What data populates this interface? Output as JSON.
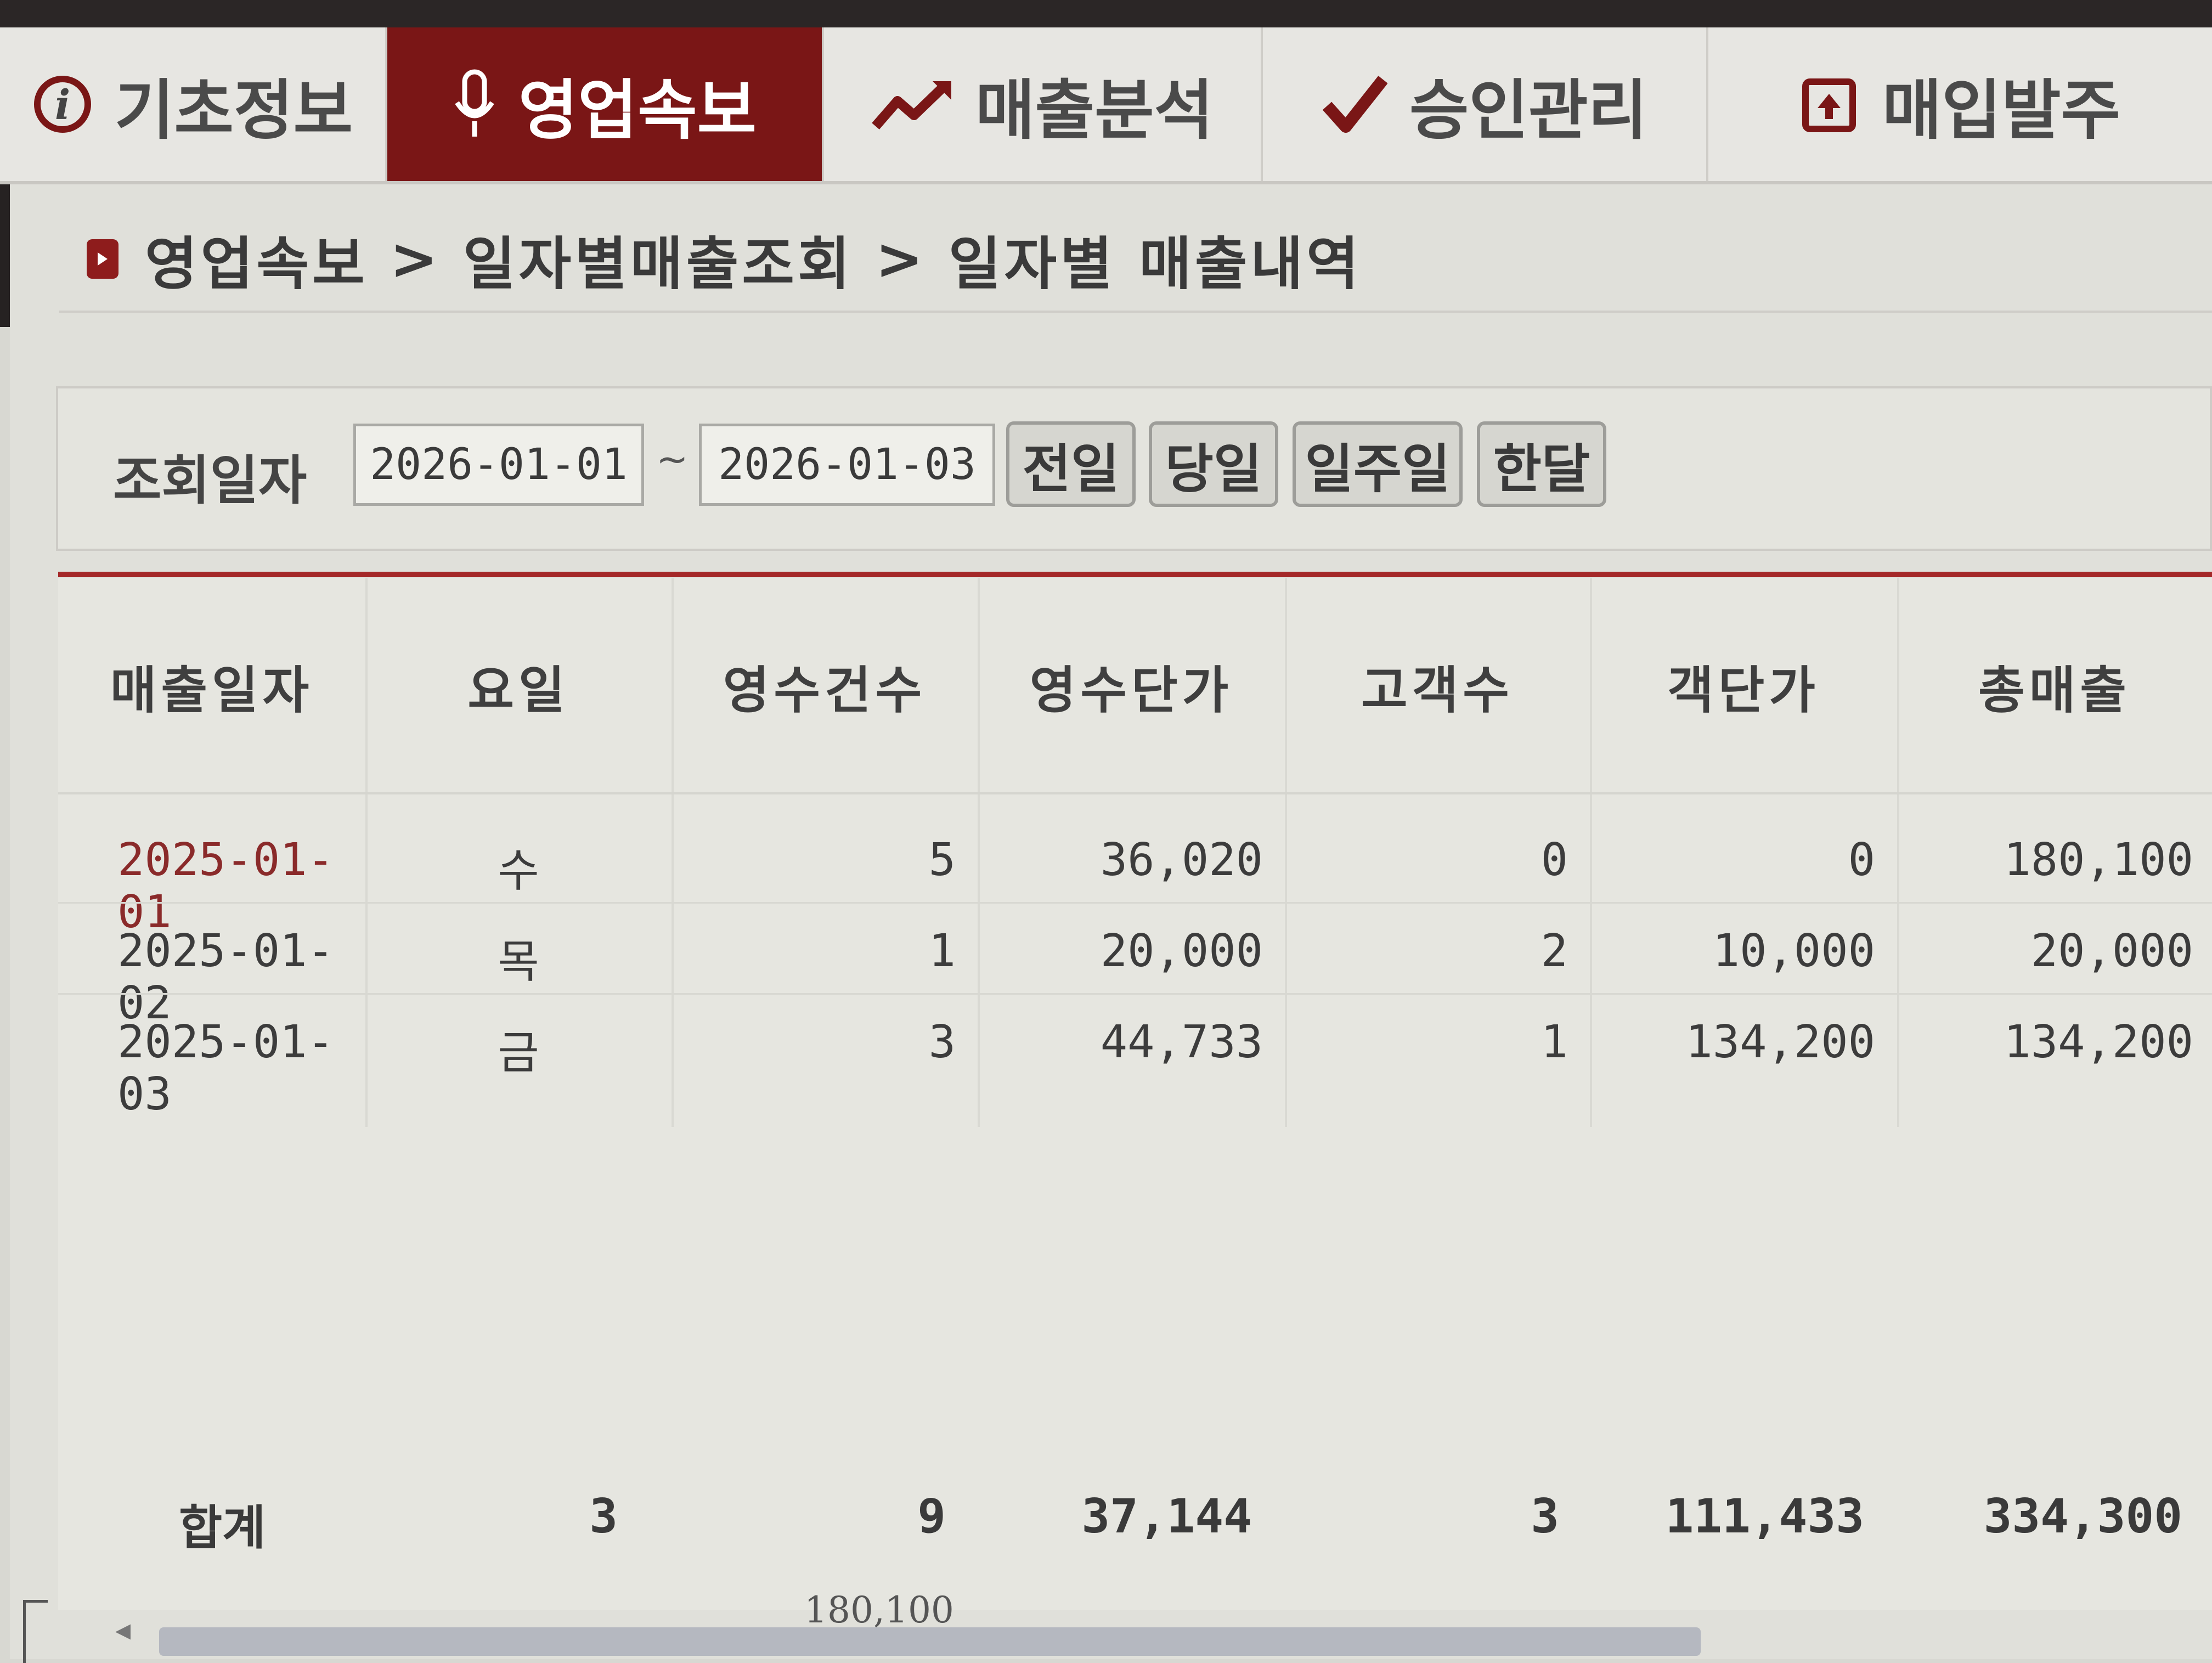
{
  "nav": {
    "tabs": [
      {
        "label": "기초정보",
        "icon": "info-icon"
      },
      {
        "label": "영업속보",
        "icon": "microphone-icon",
        "active": true
      },
      {
        "label": "매출분석",
        "icon": "trend-chart-icon"
      },
      {
        "label": "승인관리",
        "icon": "checkmark-icon"
      },
      {
        "label": "매입발주",
        "icon": "order-box-icon"
      }
    ]
  },
  "breadcrumb": {
    "level1": "영업속보",
    "level2": "일자별매출조회",
    "level3": "일자별 매출내역",
    "separator": ">"
  },
  "search": {
    "label": "조회일자",
    "from_date": "2026-01-01",
    "to_date": "2026-01-03",
    "range_separator": "~",
    "buttons": {
      "prev_day": "전일",
      "today": "당일",
      "week": "일주일",
      "month": "한달"
    }
  },
  "table": {
    "headers": [
      "매출일자",
      "요일",
      "영수건수",
      "영수단가",
      "고객수",
      "객단가",
      "총매출"
    ],
    "rows": [
      {
        "date": "2025-01-01",
        "weekday": "수",
        "receipts": "5",
        "receipt_avg": "36,020",
        "customers": "0",
        "per_customer": "0",
        "total": "180,100"
      },
      {
        "date": "2025-01-02",
        "weekday": "목",
        "receipts": "1",
        "receipt_avg": "20,000",
        "customers": "2",
        "per_customer": "10,000",
        "total": "20,000"
      },
      {
        "date": "2025-01-03",
        "weekday": "금",
        "receipts": "3",
        "receipt_avg": "44,733",
        "customers": "1",
        "per_customer": "134,200",
        "total": "134,200"
      }
    ],
    "summary": {
      "label": "합계",
      "days": "3",
      "receipts": "9",
      "receipt_avg": "37,144",
      "customers": "3",
      "per_customer": "111,433",
      "total": "334,300"
    }
  },
  "bottom_value": "180,100",
  "colors": {
    "active_tab": "#7a1616",
    "accent_line": "#a42828",
    "first_row_date": "#8a2a2a"
  }
}
